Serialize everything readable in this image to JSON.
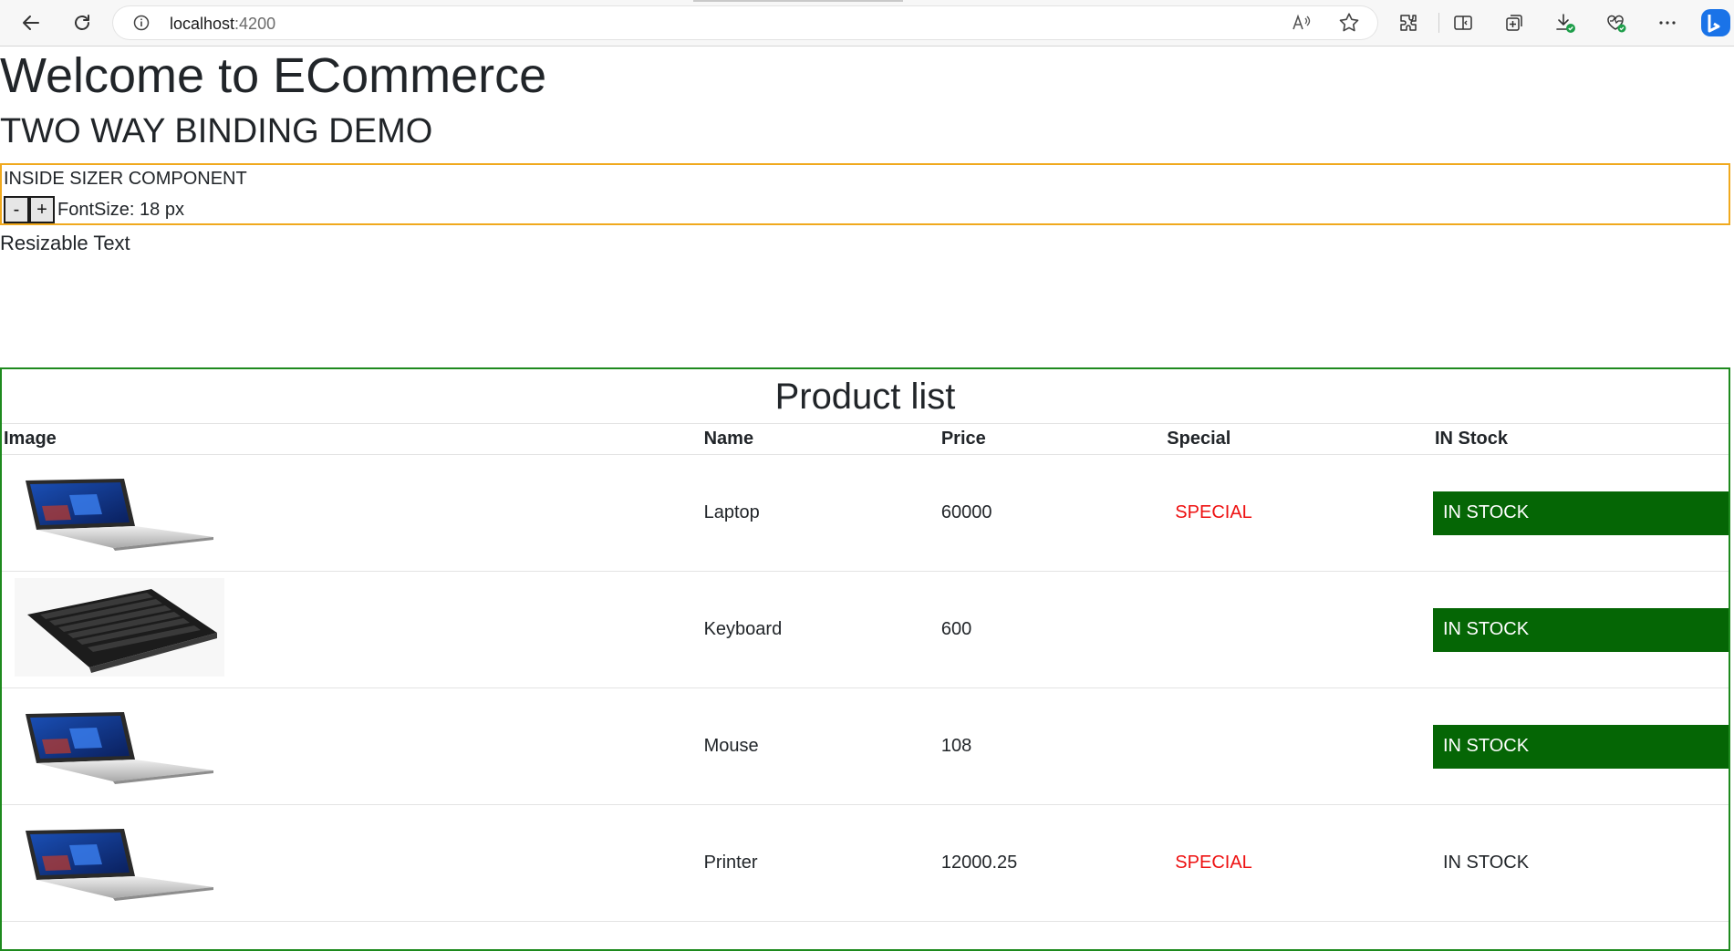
{
  "browser": {
    "url_host": "localhost",
    "url_port": ":4200",
    "icons": [
      "back-icon",
      "refresh-icon",
      "info-icon",
      "read-aloud-icon",
      "favorite-star-icon",
      "extensions-icon",
      "split-screen-icon",
      "collections-icon",
      "downloads-icon",
      "browser-essentials-icon",
      "more-icon",
      "copilot-icon"
    ]
  },
  "page": {
    "title": "Welcome to ECommerce",
    "subtitle": "TWO WAY BINDING DEMO"
  },
  "sizer": {
    "label": "INSIDE SIZER COMPONENT",
    "minus_label": "-",
    "plus_label": "+",
    "fontsize_text": "FontSize: 18 px",
    "border_color": "#f0a91e"
  },
  "resizable_text": "Resizable Text",
  "products": {
    "title": "Product list",
    "border_color": "#1e8a1e",
    "headers": {
      "image": "Image",
      "name": "Name",
      "price": "Price",
      "special": "Special",
      "instock": "IN Stock"
    },
    "rows": [
      {
        "image": "laptop",
        "name": "Laptop",
        "price": "60000",
        "special": "SPECIAL",
        "instock": "IN STOCK",
        "stock_style": "green"
      },
      {
        "image": "keyboard",
        "name": "Keyboard",
        "price": "600",
        "special": "",
        "instock": "IN STOCK",
        "stock_style": "green"
      },
      {
        "image": "laptop",
        "name": "Mouse",
        "price": "108",
        "special": "",
        "instock": "IN STOCK",
        "stock_style": "green"
      },
      {
        "image": "laptop",
        "name": "Printer",
        "price": "12000.25",
        "special": "SPECIAL",
        "instock": "IN STOCK",
        "stock_style": "plain"
      }
    ],
    "colors": {
      "special": "#ee1111",
      "instock_bg": "#056605",
      "instock_text": "#ffffff"
    }
  }
}
